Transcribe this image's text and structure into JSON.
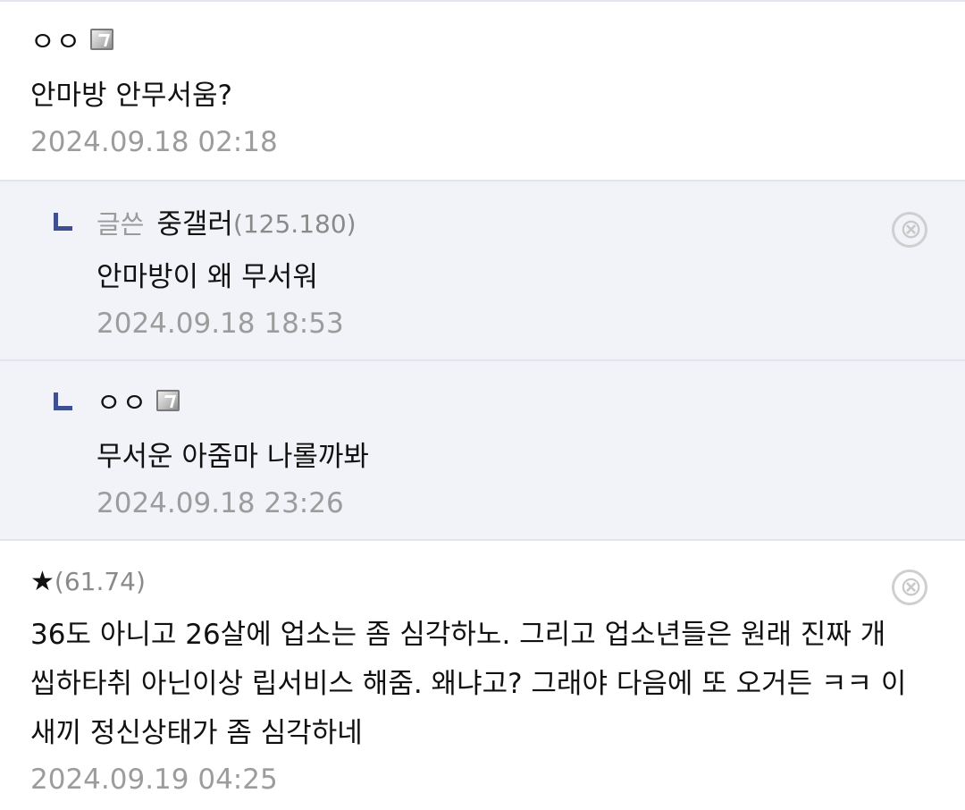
{
  "comments": [
    {
      "nick": "ㅇㅇ",
      "text": "안마방 안무서움?",
      "time": "2024.09.18 02:18"
    },
    {
      "op_label": "글쓴",
      "nick": "중갤러",
      "ip": "(125.180)",
      "text": "안마방이 왜 무서워",
      "time": "2024.09.18 18:53",
      "delete_glyph": "⊗"
    },
    {
      "nick": "ㅇㅇ",
      "text": "무서운 아줌마 나롤까봐",
      "time": "2024.09.18 23:26"
    },
    {
      "nick": "★",
      "ip": "(61.74)",
      "text": "36도 아니고 26살에 업소는 좀 심각하노. 그리고 업소년들은 원래 진짜 개씹하타취 아닌이상 립서비스 해줌. 왜냐고? 그래야 다음에 또 오거든 ㅋㅋ 이새끼 정신상태가 좀 심각하네",
      "time": "2024.09.19 04:25",
      "delete_glyph": "⊗"
    }
  ],
  "icons": {
    "fixed_nick": "fixed-nickname-icon",
    "reply": "reply-arrow-icon",
    "delete": "delete-circle-icon"
  },
  "colors": {
    "reply_bg": "#f2f3f8",
    "reply_arrow": "#3d4f8f",
    "timestamp": "#9c9c9c",
    "divider": "#e3e5ee"
  }
}
